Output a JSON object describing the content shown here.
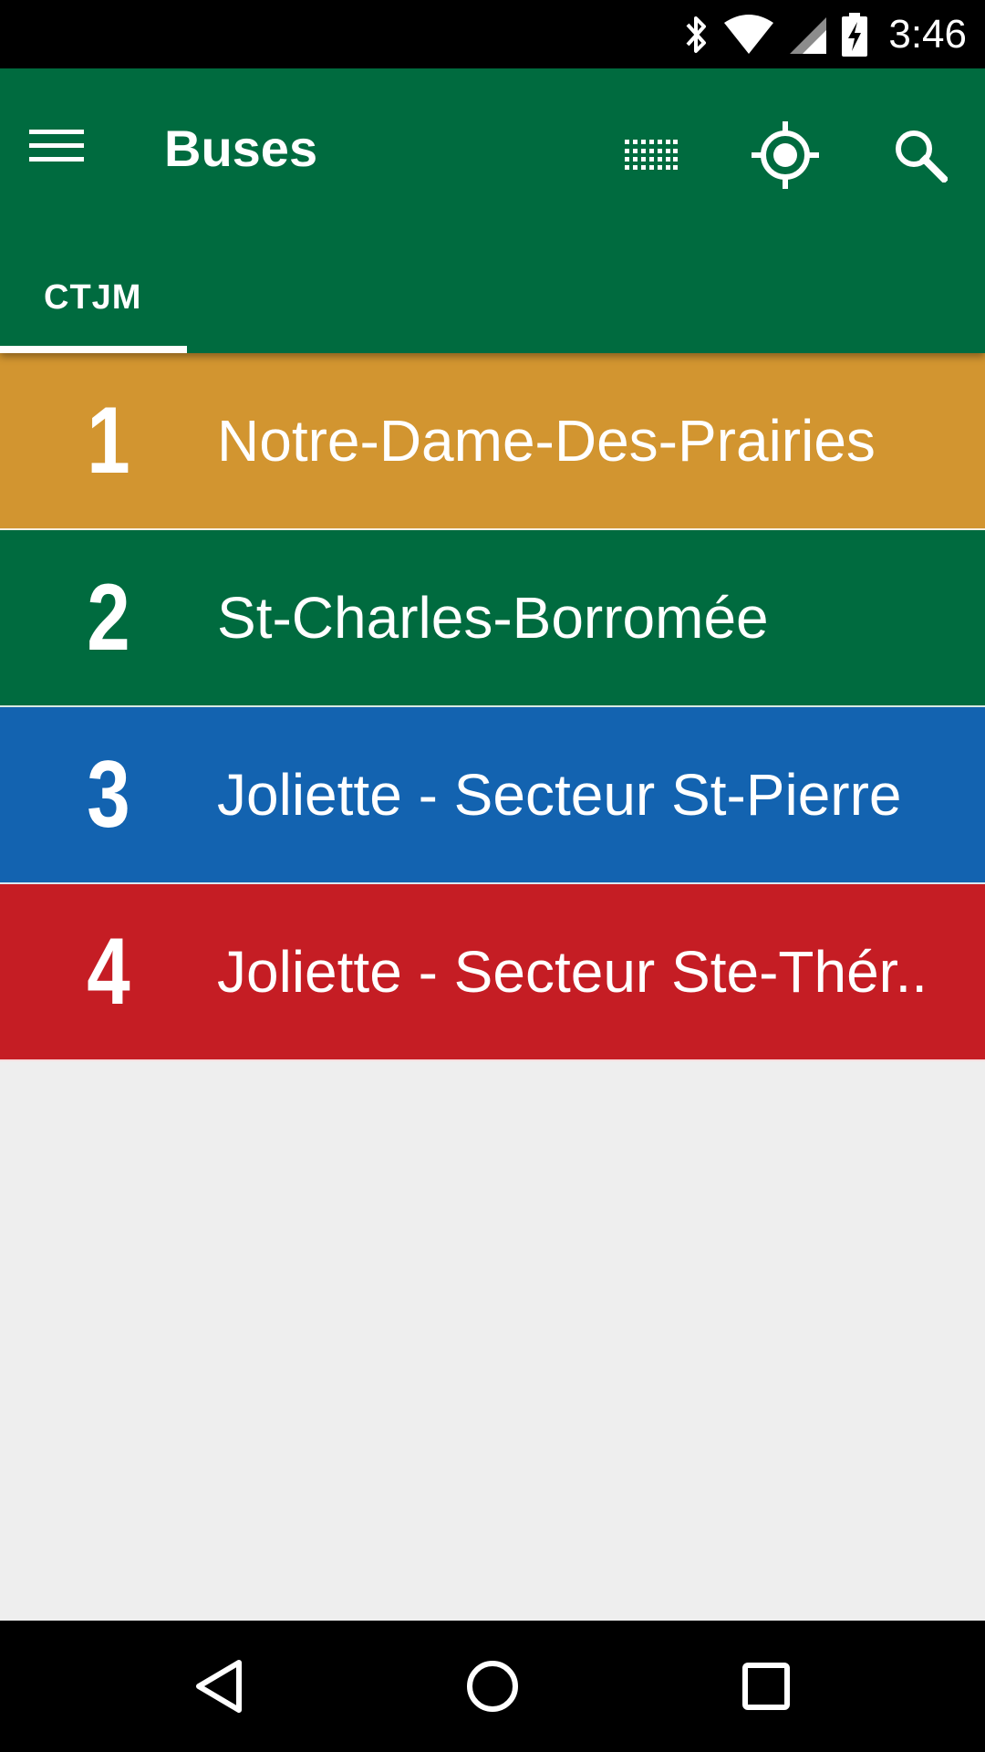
{
  "status_bar": {
    "time": "3:46",
    "icons": [
      "bluetooth-icon",
      "wifi-icon",
      "cell-signal-icon",
      "battery-charging-icon"
    ]
  },
  "app_bar": {
    "title": "Buses",
    "background_color": "#006b3f",
    "actions": [
      "menu-icon",
      "route-grid-icon",
      "my-location-icon",
      "search-icon"
    ]
  },
  "tabs": [
    {
      "label": "CTJM",
      "selected": true
    }
  ],
  "routes": [
    {
      "number": "1",
      "name": "Notre-Dame-Des-Prairies",
      "color": "#d29530"
    },
    {
      "number": "2",
      "name": "St-Charles-Borromée",
      "color": "#006b3f"
    },
    {
      "number": "3",
      "name": "Joliette - Secteur St-Pierre",
      "color": "#1363b0"
    },
    {
      "number": "4",
      "name": "Joliette - Secteur Ste-Thér..",
      "color": "#c51d24"
    }
  ],
  "nav_bar": {
    "buttons": [
      "back-icon",
      "home-icon",
      "recents-icon"
    ]
  }
}
